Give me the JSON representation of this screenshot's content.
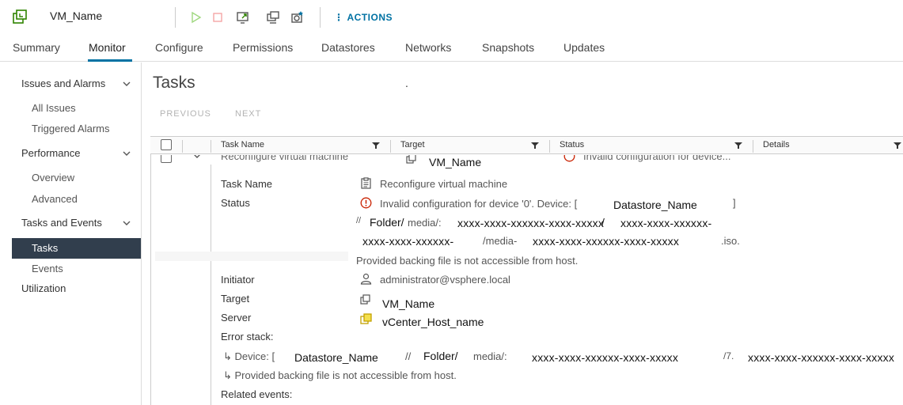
{
  "header": {
    "vm_name": "VM_Name",
    "actions_dots": "⋮",
    "actions_label": "ACTIONS"
  },
  "tabs": [
    {
      "label": "Summary"
    },
    {
      "label": "Monitor",
      "active": true
    },
    {
      "label": "Configure"
    },
    {
      "label": "Permissions"
    },
    {
      "label": "Datastores"
    },
    {
      "label": "Networks"
    },
    {
      "label": "Snapshots"
    },
    {
      "label": "Updates"
    }
  ],
  "sidebar": {
    "groups": [
      {
        "label": "Issues and Alarms",
        "items": [
          "All Issues",
          "Triggered Alarms"
        ]
      },
      {
        "label": "Performance",
        "items": [
          "Overview",
          "Advanced"
        ]
      },
      {
        "label": "Tasks and Events",
        "items": [
          "Tasks",
          "Events"
        ]
      }
    ],
    "active_item": "Tasks",
    "utilization": "Utilization"
  },
  "main": {
    "title": "Tasks",
    "dot": ".",
    "previous_label": "PREVIOUS",
    "next_label": "NEXT",
    "columns": [
      "Task Name",
      "Target",
      "Status",
      "Details"
    ],
    "row": {
      "task_name": "Reconfigure virtual machine",
      "target": "VM_Name",
      "status": "Invalid configuration for device..."
    },
    "details": {
      "task_name_label": "Task Name",
      "task_name_value": "Reconfigure virtual machine",
      "status_label": "Status",
      "status_line1_a": "Invalid configuration for device '0'. Device: [",
      "status_line1_datastore": "Datastore_Name",
      "status_line1_b": "]",
      "status_line2_a": "//",
      "status_line2_folder": "Folder/",
      "status_line2_media": "media/:",
      "status_line2_id1": "xxxx-xxxx-xxxxxx-xxxx-xxxxx",
      "status_line2_slash": "/",
      "status_line2_id2": "xxxx-xxxx-xxxxxx-",
      "status_line3_id": "xxxx-xxxx-xxxxxx-",
      "status_line3_media": "/media-",
      "status_line3_id2": "xxxx-xxxx-xxxxxx-xxxx-xxxxx",
      "status_line3_ext": ".iso.",
      "status_line4": "Provided backing file is not accessible from host.",
      "initiator_label": "Initiator",
      "initiator_value": "administrator@vsphere.local",
      "target_label": "Target",
      "target_value": "VM_Name",
      "server_label": "Server",
      "server_value": "vCenter_Host_name",
      "error_stack_label": "Error stack:",
      "err1_a": "↳ Device: [",
      "err1_datastore": "Datastore_Name",
      "err1_slashes": "//",
      "err1_folder": "Folder/",
      "err1_media": "media/:",
      "err1_id1": "xxxx-xxxx-xxxxxx-xxxx-xxxxx",
      "err1_mid": "/7.",
      "err1_id2": "xxxx-xxxx-xxxxxx-xxxx-xxxxx",
      "err2": "↳ Provided backing file is not accessible from host.",
      "related_events_label": "Related events:"
    }
  },
  "colors": {
    "accent": "#0072a3",
    "sidebar_active_bg": "#313e4d",
    "error": "#c92100",
    "green": "#2f8400"
  }
}
